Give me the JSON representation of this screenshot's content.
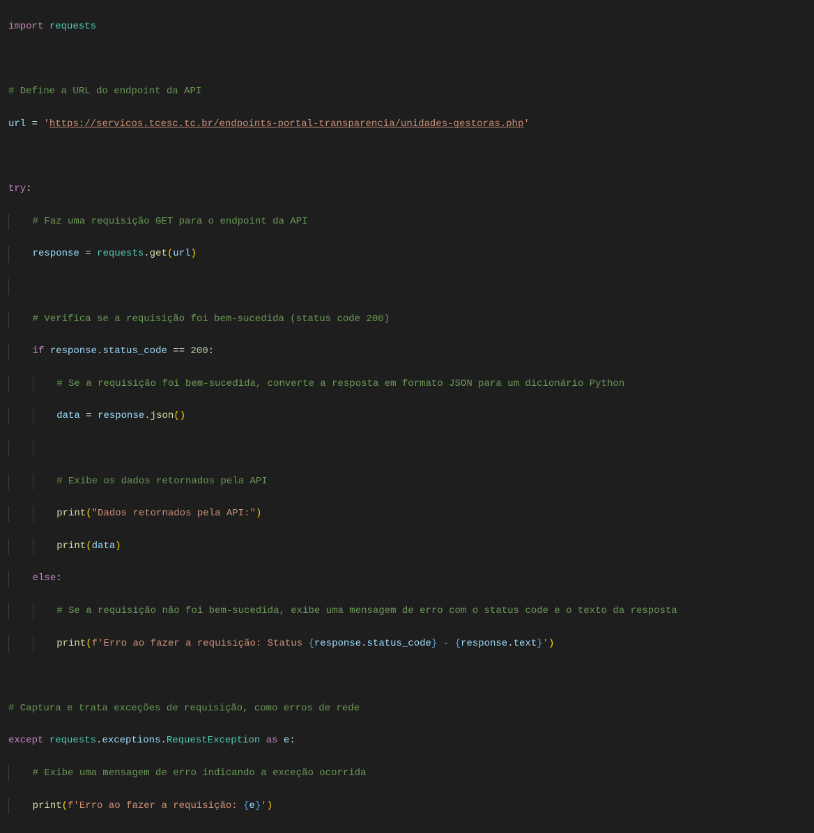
{
  "code": {
    "l1_import": "import",
    "l1_requests": "requests",
    "l3_comment": "# Define a URL do endpoint da API",
    "l4_url": "url",
    "l4_eq": " = ",
    "l4_q1": "'",
    "l4_str": "https://servicos.tcesc.tc.br/endpoints-portal-transparencia/unidades-gestoras.php",
    "l4_q2": "'",
    "l6_try": "try",
    "l6_colon": ":",
    "l7_comment": "# Faz uma requisição GET para o endpoint da API",
    "l8_response": "response",
    "l8_eq": " = ",
    "l8_requests": "requests",
    "l8_dot": ".",
    "l8_get": "get",
    "l8_lp": "(",
    "l8_url": "url",
    "l8_rp": ")",
    "l10_comment": "# Verifica se a requisição foi bem-sucedida (status code 200)",
    "l11_if": "if",
    "l11_response": "response",
    "l11_dot": ".",
    "l11_status": "status_code",
    "l11_eqeq": " == ",
    "l11_200": "200",
    "l11_colon": ":",
    "l12_comment": "# Se a requisição foi bem-sucedida, converte a resposta em formato JSON para um dicionário Python",
    "l13_data": "data",
    "l13_eq": " = ",
    "l13_response": "response",
    "l13_dot": ".",
    "l13_json": "json",
    "l13_lp": "(",
    "l13_rp": ")",
    "l15_comment": "# Exibe os dados retornados pela API",
    "l16_print": "print",
    "l16_lp": "(",
    "l16_str": "\"Dados retornados pela API:\"",
    "l16_rp": ")",
    "l17_print": "print",
    "l17_lp": "(",
    "l17_data": "data",
    "l17_rp": ")",
    "l18_else": "else",
    "l18_colon": ":",
    "l19_comment": "# Se a requisição não foi bem-sucedida, exibe uma mensagem de erro com o status code e o texto da resposta",
    "l20_print": "print",
    "l20_lp": "(",
    "l20_f": "f'Erro ao fazer a requisição: Status ",
    "l20_lb1": "{",
    "l20_resp1": "response",
    "l20_dot1": ".",
    "l20_sc": "status_code",
    "l20_rb1": "}",
    "l20_mid": " - ",
    "l20_lb2": "{",
    "l20_resp2": "response",
    "l20_dot2": ".",
    "l20_text": "text",
    "l20_rb2": "}",
    "l20_end": "'",
    "l20_rp": ")",
    "l22_comment": "# Captura e trata exceções de requisição, como erros de rede",
    "l23_except": "except",
    "l23_requests": "requests",
    "l23_dot1": ".",
    "l23_exc": "exceptions",
    "l23_dot2": ".",
    "l23_reqexc": "RequestException",
    "l23_as": "as",
    "l23_e": "e",
    "l23_colon": ":",
    "l24_comment": "# Exibe uma mensagem de erro indicando a exceção ocorrida",
    "l25_print": "print",
    "l25_lp": "(",
    "l25_f": "f'Erro ao fazer a requisição: ",
    "l25_lb": "{",
    "l25_e": "e",
    "l25_rb": "}",
    "l25_end": "'",
    "l25_rp": ")"
  }
}
